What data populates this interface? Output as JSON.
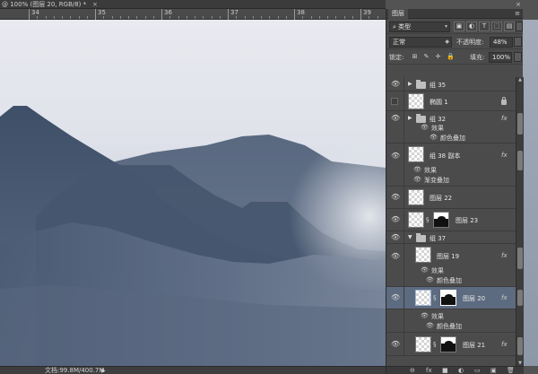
{
  "document": {
    "tab_title": "@ 100% (图层 20, RGB/8) *",
    "close_label": "×",
    "status_text": "文档:99.8M/400.7M",
    "status_arrow": "▶"
  },
  "ruler": {
    "marks": [
      "34",
      "35",
      "36",
      "37",
      "38",
      "39"
    ]
  },
  "canvas": {
    "colors": {
      "sky_top": "#f0f0f4",
      "sky_bottom": "#c6ccd6",
      "mountain_far": "#5b6b82",
      "mountain_mid": "#4a5a72",
      "mountain_near": "#3d4d64",
      "mist": "#dfe3ea"
    }
  },
  "layers_panel": {
    "tab_label": "图层",
    "panel_close": "×",
    "panel_menu": "≡",
    "filter": {
      "icon": "search-icon",
      "label": "类型"
    },
    "blend_mode": "正常",
    "opacity_label": "不透明度:",
    "opacity_value": "48%",
    "lock_label": "锁定:",
    "fill_label": "填充:",
    "fill_value": "100%",
    "layers": [
      {
        "type": "group",
        "name": "组 35",
        "visible": true,
        "expanded": false
      },
      {
        "type": "layer",
        "name": "椭圆 1",
        "visible": false,
        "locked": true,
        "thumb": "shape"
      },
      {
        "type": "group",
        "name": "组 32",
        "visible": true,
        "expanded": false,
        "fx": true,
        "effects_label": "效果",
        "effects": [
          "颜色叠加"
        ]
      },
      {
        "type": "layer",
        "name": "组 38 副本",
        "visible": true,
        "fx": true,
        "thumb": "transparent",
        "effects_label": "效果",
        "effects": [
          "渐变叠加"
        ]
      },
      {
        "type": "layer",
        "name": "图层 22",
        "visible": true,
        "thumb": "transparent"
      },
      {
        "type": "layer",
        "name": "图层 23",
        "visible": true,
        "thumb": "mask"
      },
      {
        "type": "group",
        "name": "组 37",
        "visible": true,
        "expanded": true
      },
      {
        "type": "layer",
        "name": "图层 19",
        "visible": true,
        "fx": true,
        "thumb": "transparent",
        "effects_label": "效果",
        "effects": [
          "颜色叠加"
        ]
      },
      {
        "type": "layer",
        "name": "图层 20",
        "visible": true,
        "fx": true,
        "thumb": "mask",
        "selected": true,
        "effects_label": "效果",
        "effects": [
          "颜色叠加"
        ]
      },
      {
        "type": "layer",
        "name": "图层 21",
        "visible": true,
        "fx": true,
        "thumb": "mask"
      }
    ],
    "fx_label": "fx",
    "bottom_icons": [
      "link-icon",
      "fx-icon",
      "mask-icon",
      "adjustment-icon",
      "group-icon",
      "new-layer-icon",
      "trash-icon"
    ],
    "bottom_glyphs": [
      "⊖",
      "fx",
      "■",
      "◐",
      "▭",
      "▣",
      "🗑"
    ]
  }
}
